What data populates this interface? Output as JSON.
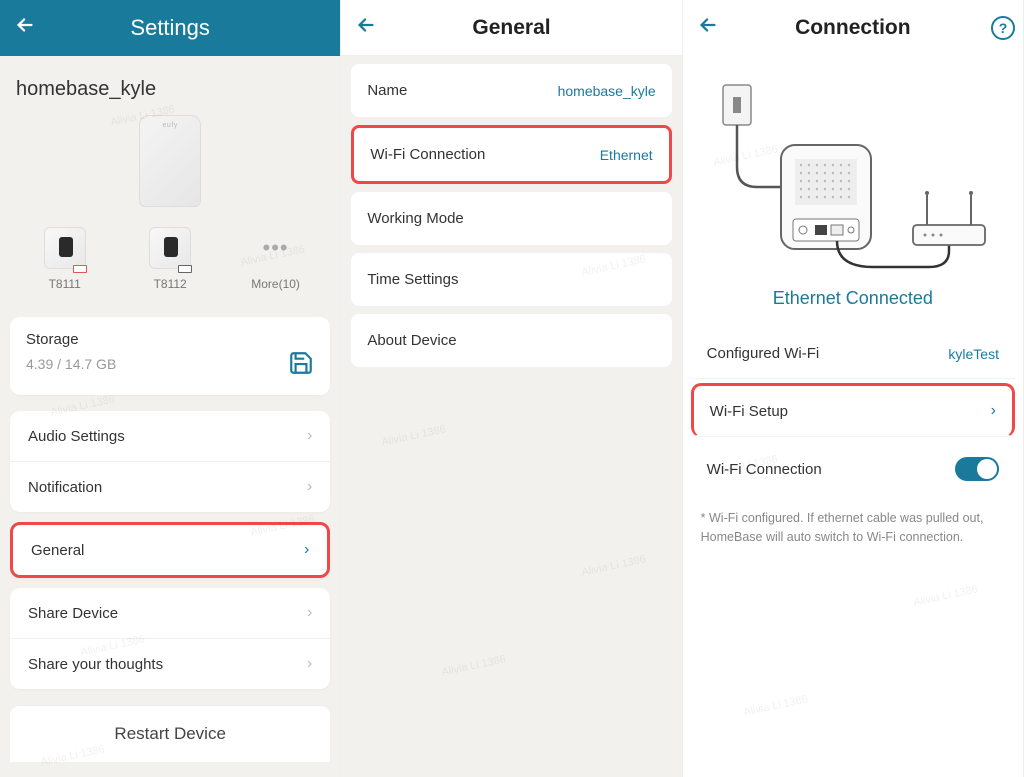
{
  "watermark": "Alivia Li 1386",
  "panel1": {
    "title": "Settings",
    "device_name": "homebase_kyle",
    "devices": [
      {
        "label": "T8111",
        "battery": "low"
      },
      {
        "label": "T8112",
        "battery": "ok"
      }
    ],
    "more_label": "More(10)",
    "storage": {
      "title": "Storage",
      "value": "4.39 / 14.7 GB"
    },
    "rows": [
      {
        "label": "Audio Settings"
      },
      {
        "label": "Notification"
      },
      {
        "label": "General",
        "highlighted": true
      },
      {
        "label": "Share Device"
      },
      {
        "label": "Share your thoughts"
      }
    ],
    "restart": "Restart Device"
  },
  "panel2": {
    "title": "General",
    "rows": [
      {
        "label": "Name",
        "value": "homebase_kyle"
      },
      {
        "label": "Wi-Fi Connection",
        "value": "Ethernet",
        "highlighted": true
      },
      {
        "label": "Working Mode"
      },
      {
        "label": "Time Settings"
      },
      {
        "label": "About Device"
      }
    ]
  },
  "panel3": {
    "title": "Connection",
    "status": "Ethernet Connected",
    "rows": [
      {
        "label": "Configured Wi-Fi",
        "value": "kyleTest"
      },
      {
        "label": "Wi-Fi Setup",
        "chevron": true,
        "highlighted": true
      },
      {
        "label": "Wi-Fi Connection",
        "toggle": true
      }
    ],
    "footnote": "* Wi-Fi configured. If ethernet cable was pulled out, HomeBase will auto switch to Wi-Fi connection."
  }
}
